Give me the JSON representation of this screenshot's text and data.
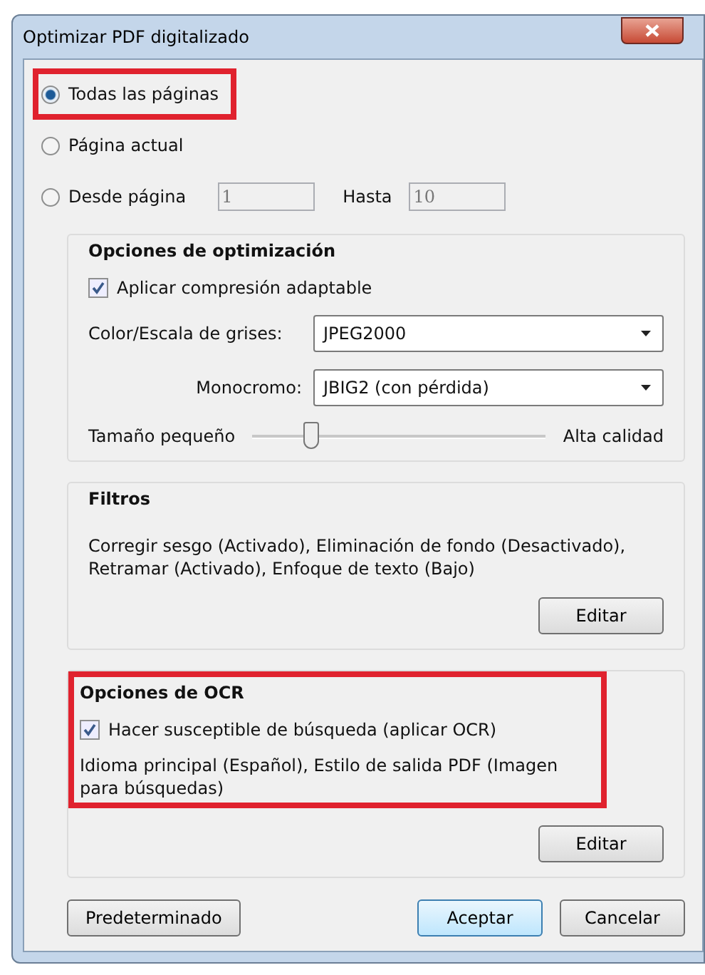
{
  "window": {
    "title": "Optimizar PDF digitalizado"
  },
  "page_range": {
    "options": [
      {
        "label": "Todas las páginas",
        "selected": true,
        "highlighted": true
      },
      {
        "label": "Página actual",
        "selected": false,
        "highlighted": false
      },
      {
        "label": "Desde página",
        "selected": false,
        "highlighted": false
      }
    ],
    "from_value": "1",
    "to_label": "Hasta",
    "to_value": "10"
  },
  "optimization": {
    "title": "Opciones de optimización",
    "adaptive": {
      "label": "Aplicar compresión adaptable",
      "checked": true
    },
    "selects": [
      {
        "label": "Color/Escala de grises:",
        "value": "JPEG2000"
      },
      {
        "label": "Monocromo:",
        "value": "JBIG2 (con pérdida)"
      }
    ],
    "slider": {
      "min_label": "Tamaño pequeño",
      "max_label": "Alta calidad",
      "level": 0.2
    }
  },
  "filters": {
    "title": "Filtros",
    "text": "Corregir sesgo (Activado), Eliminación de fondo (Desactivado), Retramar (Activado), Enfoque de texto (Bajo)",
    "button": "Editar"
  },
  "ocr": {
    "title": "Opciones de OCR",
    "highlighted": true,
    "searchable": {
      "label": "Hacer susceptible de búsqueda (aplicar OCR)",
      "checked": true
    },
    "text": "Idioma principal (Español), Estilo de salida PDF (Imagen para búsquedas)",
    "button": "Editar"
  },
  "buttons": {
    "default": "Predeterminado",
    "ok": "Aceptar",
    "cancel": "Cancelar"
  }
}
